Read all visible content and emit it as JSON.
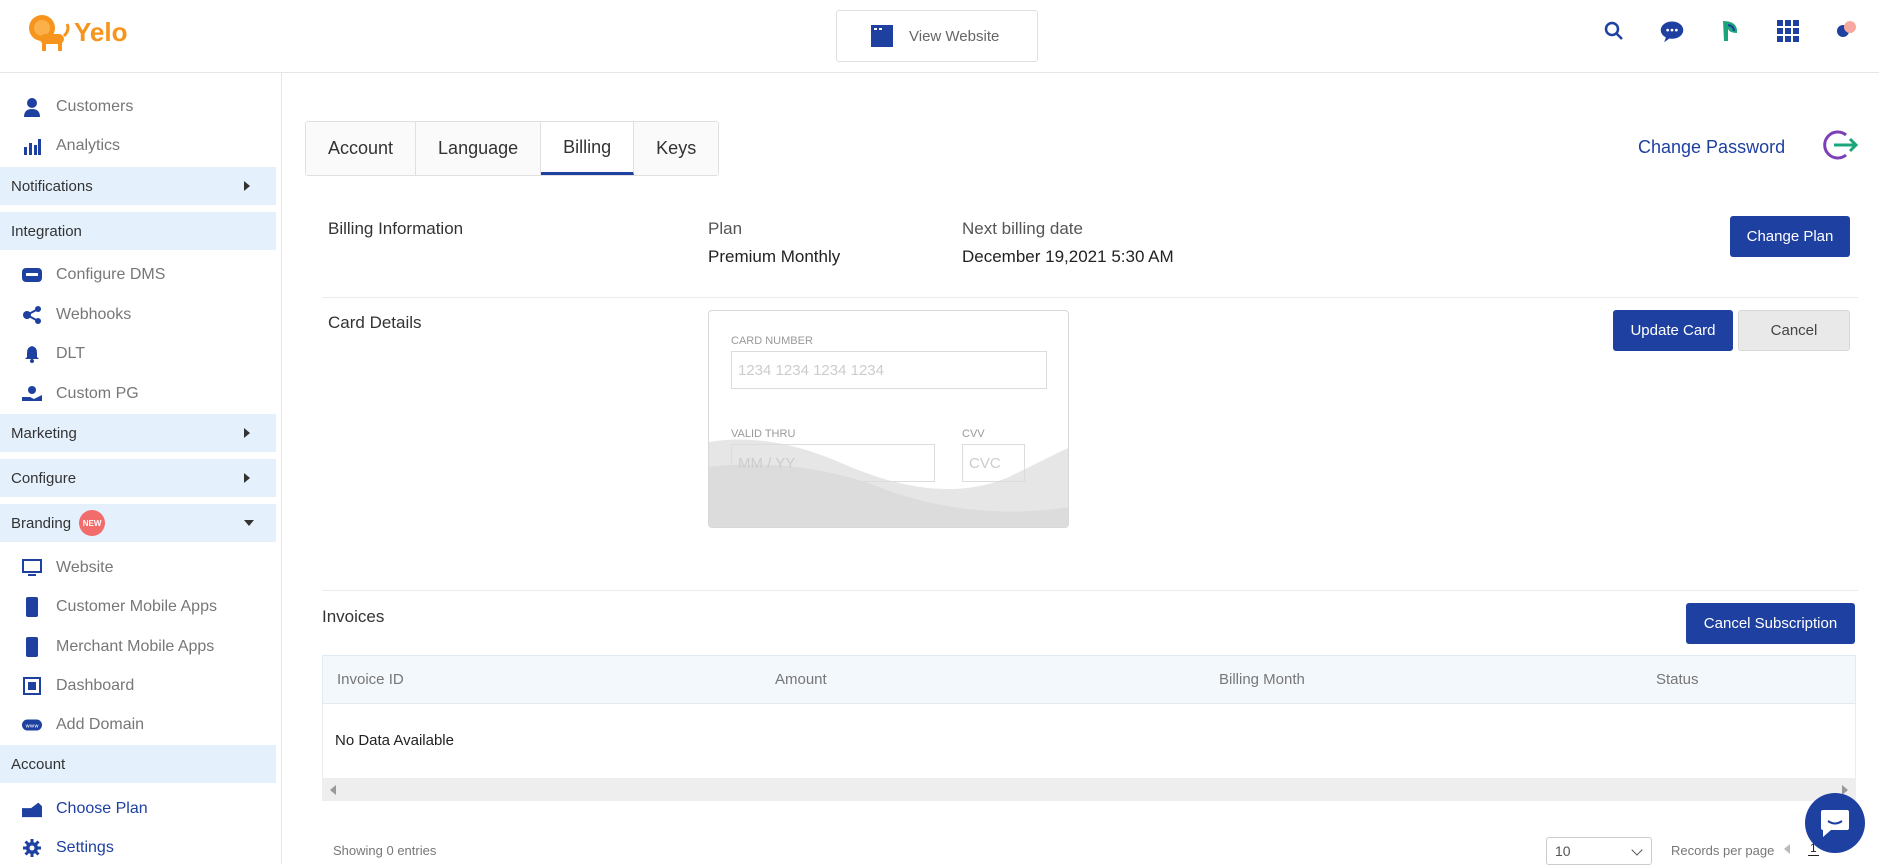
{
  "header": {
    "logo_text": "Yelo",
    "view_website_label": "View Website",
    "icons": [
      "search-icon",
      "support-chat-icon",
      "leaf-icon",
      "apps-grid-icon",
      "profile-icon"
    ]
  },
  "sidebar": {
    "items_top": [
      {
        "label": "Customers",
        "icon": "customers-icon"
      },
      {
        "label": "Analytics",
        "icon": "analytics-icon"
      }
    ],
    "notifications": "Notifications",
    "integration": "Integration",
    "integration_items": [
      {
        "label": "Configure DMS",
        "icon": "dms-icon"
      },
      {
        "label": "Webhooks",
        "icon": "webhooks-icon"
      },
      {
        "label": "DLT",
        "icon": "bell-icon"
      },
      {
        "label": "Custom PG",
        "icon": "payment-icon"
      }
    ],
    "marketing": "Marketing",
    "configure": "Configure",
    "branding": "Branding",
    "branding_badge": "NEW",
    "branding_items": [
      {
        "label": "Website",
        "icon": "monitor-icon"
      },
      {
        "label": "Customer Mobile Apps",
        "icon": "mobile-icon"
      },
      {
        "label": "Merchant Mobile Apps",
        "icon": "mobile-icon"
      },
      {
        "label": "Dashboard",
        "icon": "dashboard-icon"
      },
      {
        "label": "Add Domain",
        "icon": "www-icon"
      }
    ],
    "account": "Account",
    "account_items": [
      {
        "label": "Choose Plan",
        "icon": "plan-icon"
      },
      {
        "label": "Settings",
        "icon": "gear-icon"
      }
    ]
  },
  "tabs": [
    {
      "label": "Account",
      "active": false
    },
    {
      "label": "Language",
      "active": false
    },
    {
      "label": "Billing",
      "active": true
    },
    {
      "label": "Keys",
      "active": false
    }
  ],
  "change_password": "Change Password",
  "billing": {
    "section_label": "Billing Information",
    "plan_label": "Plan",
    "plan_value": "Premium Monthly",
    "next_billing_label": "Next billing date",
    "next_billing_value": "December 19,2021 5:30 AM",
    "change_plan_button": "Change Plan"
  },
  "card": {
    "section_label": "Card Details",
    "card_number_label": "CARD NUMBER",
    "card_number_placeholder": "1234 1234 1234 1234",
    "valid_thru_label": "VALID THRU",
    "valid_thru_placeholder": "MM / YY",
    "cvv_label": "CVV",
    "cvv_placeholder": "CVC",
    "update_button": "Update Card",
    "cancel_button": "Cancel"
  },
  "invoices": {
    "section_label": "Invoices",
    "cancel_subscription_button": "Cancel Subscription",
    "columns": [
      "Invoice ID",
      "Amount",
      "Billing Month",
      "Status"
    ],
    "empty_text": "No Data Available",
    "showing_text": "Showing 0 entries",
    "per_page_value": "10",
    "records_per_page_label": "Records per page",
    "current_page": "1"
  },
  "colors": {
    "primary": "#1e40a0",
    "logo": "#f7941d",
    "sidebar_section_bg": "#e4f1fc",
    "new_badge": "#f36c6c"
  }
}
